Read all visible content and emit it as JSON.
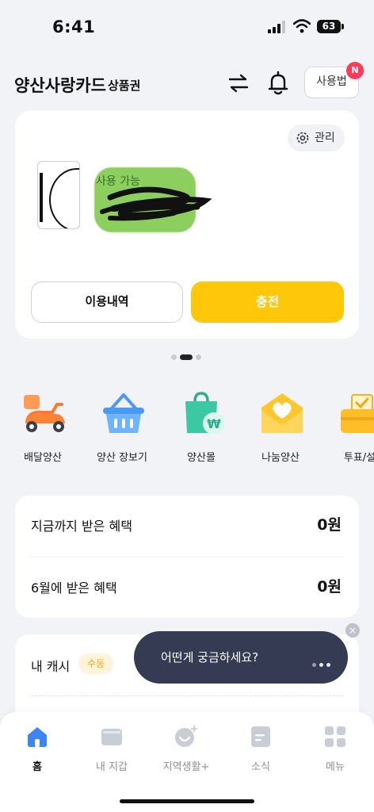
{
  "status_bar": {
    "time": "6:41",
    "battery": "63"
  },
  "header": {
    "title": "양산사랑카드",
    "subtitle": "상품권",
    "howto_label": "사용법",
    "new_badge": "N"
  },
  "card": {
    "manage_label": "관리",
    "available_label": "사용 가능",
    "history_button": "이용내역",
    "charge_button": "충전",
    "page_count": 3,
    "active_page": 2
  },
  "quick_menu": [
    {
      "label": "배달양산",
      "icon": "delivery-scooter-icon"
    },
    {
      "label": "양산 장보기",
      "icon": "shopping-basket-icon"
    },
    {
      "label": "양산몰",
      "icon": "shopping-bag-won-icon"
    },
    {
      "label": "나눔양산",
      "icon": "heart-envelope-icon"
    },
    {
      "label": "투표/설",
      "icon": "ballot-box-icon"
    }
  ],
  "benefits": {
    "total_label": "지금까지 받은 혜택",
    "total_value": "0원",
    "month_label": "6월에 받은 혜택",
    "month_value": "0원"
  },
  "cash": {
    "label": "내 캐시",
    "badge": "수동"
  },
  "chat": {
    "prompt": "어떤게 궁금하세요?",
    "close": "×"
  },
  "tabbar": [
    {
      "label": "홈",
      "icon": "home-icon",
      "active": true
    },
    {
      "label": "내 지갑",
      "icon": "wallet-icon",
      "active": false
    },
    {
      "label": "지역생활+",
      "icon": "local-life-icon",
      "active": false
    },
    {
      "label": "소식",
      "icon": "news-icon",
      "active": false
    },
    {
      "label": "메뉴",
      "icon": "menu-grid-icon",
      "active": false
    }
  ],
  "colors": {
    "accent": "#ffc70a",
    "background": "#f1f3f7",
    "chat_bg": "#353b52",
    "badge_red": "#ff3b5c",
    "active_tab": "#3d84f5"
  }
}
